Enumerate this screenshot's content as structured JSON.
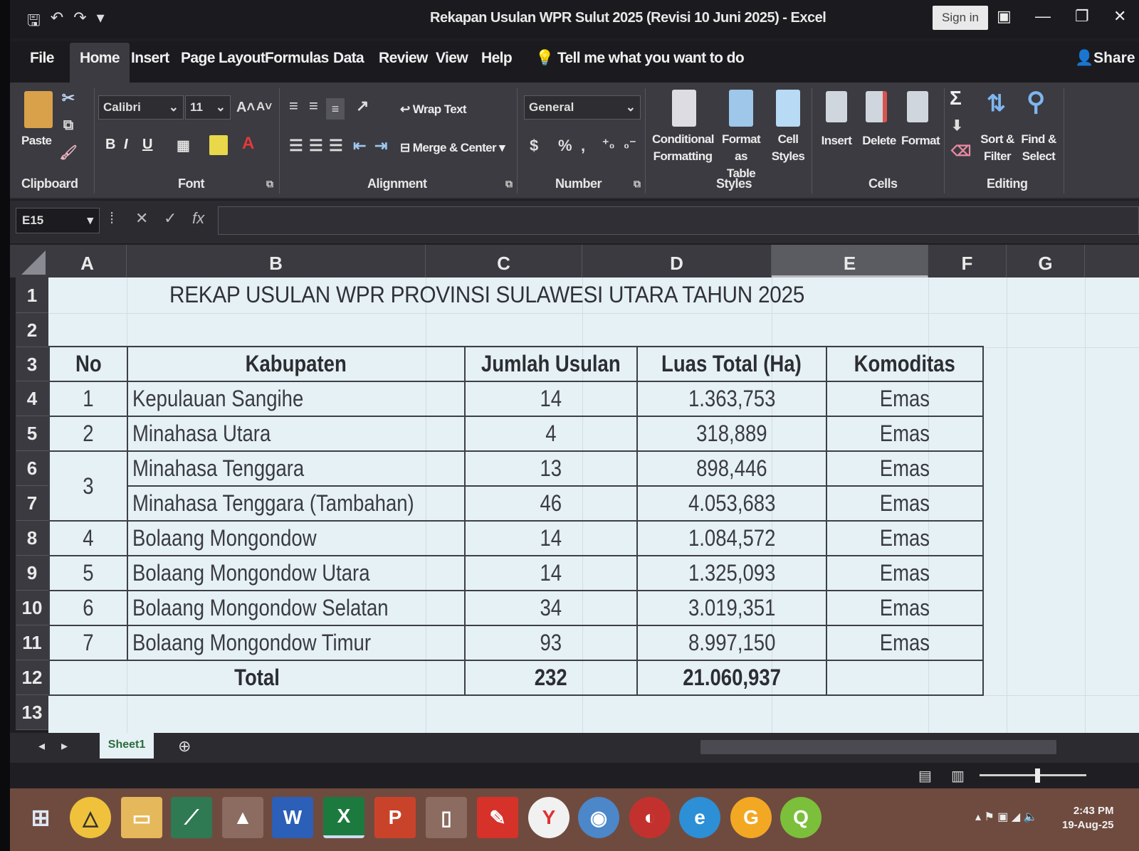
{
  "window": {
    "title": "Rekapan Usulan WPR Sulut 2025 (Revisi 10 Juni 2025) - Excel",
    "sign_in": "Sign in",
    "share": "Share"
  },
  "menu": {
    "tabs": [
      "File",
      "Home",
      "Insert",
      "Page Layout",
      "Formulas",
      "Data",
      "Review",
      "View",
      "Help"
    ],
    "active": "Home",
    "tell_me": "Tell me what you want to do"
  },
  "ribbon": {
    "clipboard": {
      "paste": "Paste",
      "label": "Clipboard"
    },
    "font": {
      "name": "Calibri",
      "size": "11",
      "label": "Font",
      "bold": "B",
      "italic": "I",
      "underline": "U"
    },
    "alignment": {
      "wrap": "Wrap Text",
      "merge": "Merge & Center",
      "label": "Alignment"
    },
    "number": {
      "format": "General",
      "currency": "$",
      "percent": "%",
      "comma": ",",
      "label": "Number"
    },
    "styles": {
      "conditional": [
        "Conditional",
        "Formatting"
      ],
      "format_table": [
        "Format as",
        "Table"
      ],
      "cell_styles": [
        "Cell",
        "Styles"
      ],
      "label": "Styles"
    },
    "cells": {
      "insert": "Insert",
      "delete": "Delete",
      "format": "Format",
      "label": "Cells"
    },
    "editing": {
      "sort": [
        "Sort &",
        "Filter"
      ],
      "find": [
        "Find &",
        "Select"
      ],
      "label": "Editing",
      "sum": "Σ"
    }
  },
  "formula_bar": {
    "name_box": "E15",
    "formula": ""
  },
  "columns": [
    "A",
    "B",
    "C",
    "D",
    "E",
    "F",
    "G"
  ],
  "selected_column": "E",
  "rows": [
    "1",
    "2",
    "3",
    "4",
    "5",
    "6",
    "7",
    "8",
    "9",
    "10",
    "11",
    "12",
    "13"
  ],
  "sheet": {
    "title": "REKAP USULAN WPR PROVINSI SULAWESI UTARA TAHUN 2025",
    "headers": [
      "No",
      "Kabupaten",
      "Jumlah Usulan",
      "Luas Total (Ha)",
      "Komoditas"
    ],
    "records": [
      {
        "no": "1",
        "kab": "Kepulauan Sangihe",
        "jumlah": "14",
        "luas": "1.363,753",
        "kom": "Emas"
      },
      {
        "no": "2",
        "kab": "Minahasa Utara",
        "jumlah": "4",
        "luas": "318,889",
        "kom": "Emas"
      },
      {
        "no": "3",
        "kab": "Minahasa Tenggara",
        "jumlah": "13",
        "luas": "898,446",
        "kom": "Emas"
      },
      {
        "no": "",
        "kab": "Minahasa Tenggara (Tambahan)",
        "jumlah": "46",
        "luas": "4.053,683",
        "kom": "Emas"
      },
      {
        "no": "4",
        "kab": "Bolaang Mongondow",
        "jumlah": "14",
        "luas": "1.084,572",
        "kom": "Emas"
      },
      {
        "no": "5",
        "kab": "Bolaang Mongondow Utara",
        "jumlah": "14",
        "luas": "1.325,093",
        "kom": "Emas"
      },
      {
        "no": "6",
        "kab": "Bolaang Mongondow Selatan",
        "jumlah": "34",
        "luas": "3.019,351",
        "kom": "Emas"
      },
      {
        "no": "7",
        "kab": "Bolaang Mongondow Timur",
        "jumlah": "93",
        "luas": "8.997,150",
        "kom": "Emas"
      }
    ],
    "total": {
      "label": "Total",
      "jumlah": "232",
      "luas": "21.060,937",
      "kom": ""
    }
  },
  "sheet_tabs": {
    "active": "Sheet1"
  },
  "taskbar": {
    "time": "2:43 PM",
    "date": "19-Aug-25"
  },
  "colors": {
    "accent": "#3b3b41",
    "sheet_bg": "#e6f1f6",
    "excel_green": "#1d7a3e"
  }
}
